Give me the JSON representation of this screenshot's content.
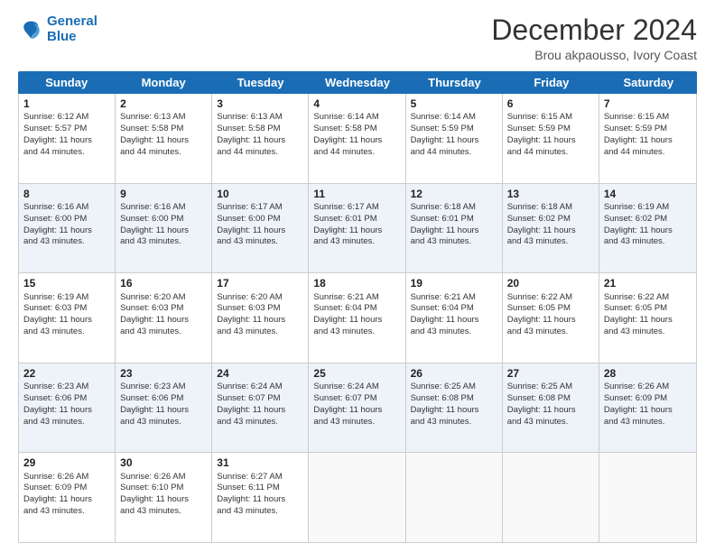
{
  "logo": {
    "line1": "General",
    "line2": "Blue"
  },
  "title": "December 2024",
  "subtitle": "Brou akpaousso, Ivory Coast",
  "days": [
    "Sunday",
    "Monday",
    "Tuesday",
    "Wednesday",
    "Thursday",
    "Friday",
    "Saturday"
  ],
  "weeks": [
    [
      {
        "day": "1",
        "sunrise": "6:12 AM",
        "sunset": "5:57 PM",
        "daylight": "11 hours and 44 minutes."
      },
      {
        "day": "2",
        "sunrise": "6:13 AM",
        "sunset": "5:58 PM",
        "daylight": "11 hours and 44 minutes."
      },
      {
        "day": "3",
        "sunrise": "6:13 AM",
        "sunset": "5:58 PM",
        "daylight": "11 hours and 44 minutes."
      },
      {
        "day": "4",
        "sunrise": "6:14 AM",
        "sunset": "5:58 PM",
        "daylight": "11 hours and 44 minutes."
      },
      {
        "day": "5",
        "sunrise": "6:14 AM",
        "sunset": "5:59 PM",
        "daylight": "11 hours and 44 minutes."
      },
      {
        "day": "6",
        "sunrise": "6:15 AM",
        "sunset": "5:59 PM",
        "daylight": "11 hours and 44 minutes."
      },
      {
        "day": "7",
        "sunrise": "6:15 AM",
        "sunset": "5:59 PM",
        "daylight": "11 hours and 44 minutes."
      }
    ],
    [
      {
        "day": "8",
        "sunrise": "6:16 AM",
        "sunset": "6:00 PM",
        "daylight": "11 hours and 43 minutes."
      },
      {
        "day": "9",
        "sunrise": "6:16 AM",
        "sunset": "6:00 PM",
        "daylight": "11 hours and 43 minutes."
      },
      {
        "day": "10",
        "sunrise": "6:17 AM",
        "sunset": "6:00 PM",
        "daylight": "11 hours and 43 minutes."
      },
      {
        "day": "11",
        "sunrise": "6:17 AM",
        "sunset": "6:01 PM",
        "daylight": "11 hours and 43 minutes."
      },
      {
        "day": "12",
        "sunrise": "6:18 AM",
        "sunset": "6:01 PM",
        "daylight": "11 hours and 43 minutes."
      },
      {
        "day": "13",
        "sunrise": "6:18 AM",
        "sunset": "6:02 PM",
        "daylight": "11 hours and 43 minutes."
      },
      {
        "day": "14",
        "sunrise": "6:19 AM",
        "sunset": "6:02 PM",
        "daylight": "11 hours and 43 minutes."
      }
    ],
    [
      {
        "day": "15",
        "sunrise": "6:19 AM",
        "sunset": "6:03 PM",
        "daylight": "11 hours and 43 minutes."
      },
      {
        "day": "16",
        "sunrise": "6:20 AM",
        "sunset": "6:03 PM",
        "daylight": "11 hours and 43 minutes."
      },
      {
        "day": "17",
        "sunrise": "6:20 AM",
        "sunset": "6:03 PM",
        "daylight": "11 hours and 43 minutes."
      },
      {
        "day": "18",
        "sunrise": "6:21 AM",
        "sunset": "6:04 PM",
        "daylight": "11 hours and 43 minutes."
      },
      {
        "day": "19",
        "sunrise": "6:21 AM",
        "sunset": "6:04 PM",
        "daylight": "11 hours and 43 minutes."
      },
      {
        "day": "20",
        "sunrise": "6:22 AM",
        "sunset": "6:05 PM",
        "daylight": "11 hours and 43 minutes."
      },
      {
        "day": "21",
        "sunrise": "6:22 AM",
        "sunset": "6:05 PM",
        "daylight": "11 hours and 43 minutes."
      }
    ],
    [
      {
        "day": "22",
        "sunrise": "6:23 AM",
        "sunset": "6:06 PM",
        "daylight": "11 hours and 43 minutes."
      },
      {
        "day": "23",
        "sunrise": "6:23 AM",
        "sunset": "6:06 PM",
        "daylight": "11 hours and 43 minutes."
      },
      {
        "day": "24",
        "sunrise": "6:24 AM",
        "sunset": "6:07 PM",
        "daylight": "11 hours and 43 minutes."
      },
      {
        "day": "25",
        "sunrise": "6:24 AM",
        "sunset": "6:07 PM",
        "daylight": "11 hours and 43 minutes."
      },
      {
        "day": "26",
        "sunrise": "6:25 AM",
        "sunset": "6:08 PM",
        "daylight": "11 hours and 43 minutes."
      },
      {
        "day": "27",
        "sunrise": "6:25 AM",
        "sunset": "6:08 PM",
        "daylight": "11 hours and 43 minutes."
      },
      {
        "day": "28",
        "sunrise": "6:26 AM",
        "sunset": "6:09 PM",
        "daylight": "11 hours and 43 minutes."
      }
    ],
    [
      {
        "day": "29",
        "sunrise": "6:26 AM",
        "sunset": "6:09 PM",
        "daylight": "11 hours and 43 minutes."
      },
      {
        "day": "30",
        "sunrise": "6:26 AM",
        "sunset": "6:10 PM",
        "daylight": "11 hours and 43 minutes."
      },
      {
        "day": "31",
        "sunrise": "6:27 AM",
        "sunset": "6:11 PM",
        "daylight": "11 hours and 43 minutes."
      },
      null,
      null,
      null,
      null
    ]
  ],
  "labels": {
    "sunrise": "Sunrise: ",
    "sunset": "Sunset: ",
    "daylight": "Daylight: "
  }
}
